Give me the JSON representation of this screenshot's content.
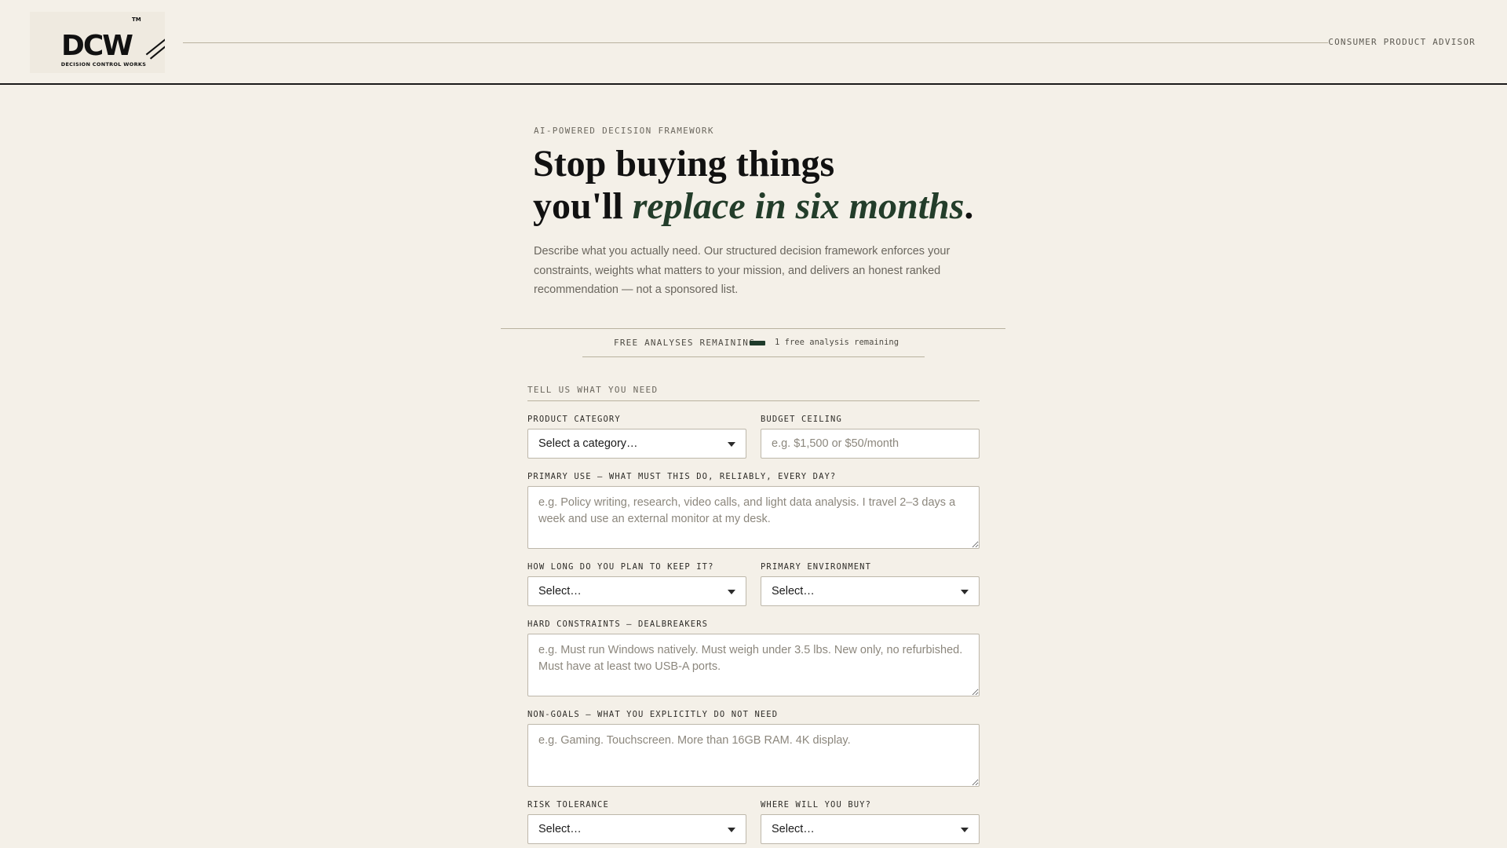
{
  "header": {
    "logo_letters": "DCW",
    "logo_tm": "TM",
    "logo_subtitle": "DECISION CONTROL WORKS",
    "tagline": "CONSUMER PRODUCT ADVISOR"
  },
  "hero": {
    "eyebrow": "AI-POWERED DECISION FRAMEWORK",
    "headline_line1": "Stop buying things",
    "headline_line2_plain": "you'll ",
    "headline_line2_accent": "replace in six months",
    "headline_period": ".",
    "intro": "Describe what you actually need. Our structured decision framework enforces your constraints, weights what matters to your mission, and delivers an honest ranked recommendation — not a sponsored list."
  },
  "quota": {
    "label": "FREE ANALYSES REMAINING",
    "remaining_fraction": 1.0,
    "text": "1 free analysis remaining"
  },
  "form": {
    "section_label": "TELL US WHAT YOU NEED",
    "category": {
      "label": "PRODUCT CATEGORY",
      "value": "Select a category…"
    },
    "budget": {
      "label": "BUDGET CEILING",
      "placeholder": "e.g. $1,500 or $50/month",
      "value": ""
    },
    "primary_use": {
      "label": "PRIMARY USE — WHAT MUST THIS DO, RELIABLY, EVERY DAY?",
      "placeholder": "e.g. Policy writing, research, video calls, and light data analysis. I travel 2–3 days a week and use an external monitor at my desk."
    },
    "keep_duration": {
      "label": "HOW LONG DO YOU PLAN TO KEEP IT?",
      "value": "Select…"
    },
    "environment": {
      "label": "PRIMARY ENVIRONMENT",
      "value": "Select…"
    },
    "hard_constraints": {
      "label": "HARD CONSTRAINTS — DEALBREAKERS",
      "placeholder": "e.g. Must run Windows natively. Must weigh under 3.5 lbs. New only, no refurbished. Must have at least two USB-A ports."
    },
    "non_goals": {
      "label": "NON-GOALS — WHAT YOU EXPLICITLY DO NOT NEED",
      "placeholder": "e.g. Gaming. Touchscreen. More than 16GB RAM. 4K display."
    },
    "risk_tolerance": {
      "label": "RISK TOLERANCE",
      "value": "Select…"
    },
    "where_buy": {
      "label": "WHERE WILL YOU BUY?",
      "value": "Select…"
    }
  },
  "colors": {
    "background": "#f4f0e8",
    "accent_green": "#233d2a",
    "rule": "#b9b29f"
  }
}
